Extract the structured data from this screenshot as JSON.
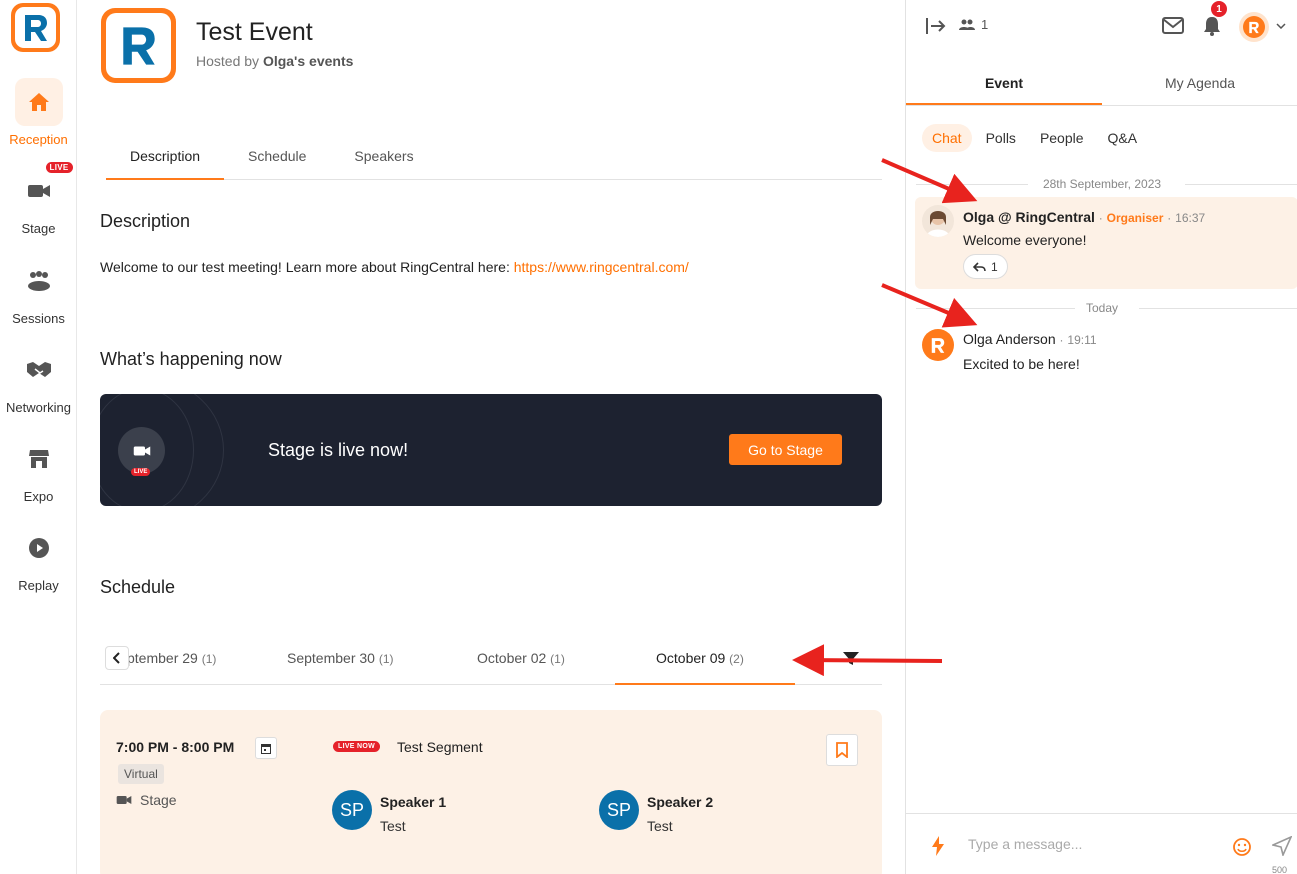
{
  "nav": {
    "items": [
      {
        "label": "Reception",
        "icon": "home-icon",
        "active": true
      },
      {
        "label": "Stage",
        "icon": "video-camera-icon",
        "badge": "LIVE"
      },
      {
        "label": "Sessions",
        "icon": "people-group-icon"
      },
      {
        "label": "Networking",
        "icon": "handshake-icon"
      },
      {
        "label": "Expo",
        "icon": "storefront-icon"
      },
      {
        "label": "Replay",
        "icon": "play-circle-icon"
      }
    ]
  },
  "event": {
    "title": "Test Event",
    "hosted_prefix": "Hosted by",
    "host": "Olga's events"
  },
  "tabs": [
    "Description",
    "Schedule",
    "Speakers"
  ],
  "description": {
    "heading": "Description",
    "text": "Welcome to our test meeting! Learn more about RingCentral here:",
    "link": "https://www.ringcentral.com/"
  },
  "happening": {
    "heading": "What’s happening now",
    "live_badge": "LIVE",
    "text": "Stage is live now!",
    "button": "Go to Stage"
  },
  "schedule": {
    "heading": "Schedule",
    "dates": [
      {
        "label": "ptember 29",
        "count": "(1)"
      },
      {
        "label": "September 30",
        "count": "(1)"
      },
      {
        "label": "October 02",
        "count": "(1)"
      },
      {
        "label": "October 09",
        "count": "(2)",
        "active": true
      }
    ],
    "session": {
      "time": "7:00 PM - 8:00 PM",
      "type": "Virtual",
      "location": "Stage",
      "live_badge": "LIVE NOW",
      "title": "Test Segment",
      "speakers": [
        {
          "initials": "SP",
          "name": "Speaker 1",
          "role": "Test"
        },
        {
          "initials": "SP",
          "name": "Speaker 2",
          "role": "Test"
        }
      ]
    }
  },
  "right_panel": {
    "attendee_count": "1",
    "notification_count": "1",
    "tabs": [
      "Event",
      "My Agenda"
    ],
    "subtabs": [
      "Chat",
      "Polls",
      "People",
      "Q&A"
    ],
    "date_divider_1": "28th September, 2023",
    "date_divider_2": "Today",
    "messages": [
      {
        "author": "Olga @ RingCentral",
        "role": "Organiser",
        "sep": "·",
        "time": "16:37",
        "text": "Welcome everyone!",
        "reply_count": "1"
      },
      {
        "author": "Olga Anderson",
        "sep": "·",
        "time": "19:11",
        "text": "Excited to be here!"
      }
    ],
    "composer_placeholder": "Type a message...",
    "char_limit": "500"
  },
  "colors": {
    "brand_orange": "#ff7a1a",
    "brand_blue": "#0a70a9",
    "live_red": "#e5222a",
    "banner_dark": "#1d2230"
  }
}
